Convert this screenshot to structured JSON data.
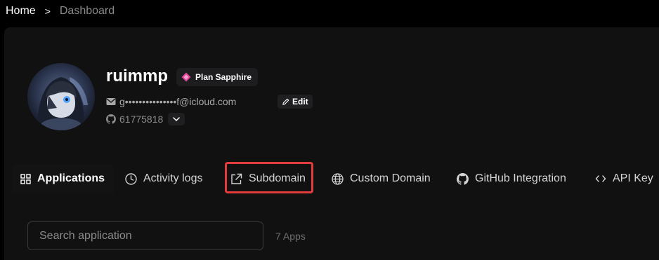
{
  "breadcrumb": {
    "home": "Home",
    "separator": ">",
    "current": "Dashboard"
  },
  "profile": {
    "username": "ruimmp",
    "plan_label": "Plan Sapphire",
    "email": "g•••••••••••••••f@icloud.com",
    "edit_label": "Edit",
    "github_id": "61775818",
    "plan_color": "#e0449c"
  },
  "tabs": [
    {
      "label": "Applications",
      "icon": "grid-icon",
      "active": true
    },
    {
      "label": "Activity logs",
      "icon": "clock-icon",
      "active": false
    },
    {
      "label": "Subdomain",
      "icon": "external-link-icon",
      "active": false
    },
    {
      "label": "Custom Domain",
      "icon": "globe-icon",
      "active": false
    },
    {
      "label": "GitHub Integration",
      "icon": "github-icon",
      "active": false
    },
    {
      "label": "API Key",
      "icon": "code-icon",
      "active": false
    }
  ],
  "search": {
    "placeholder": "Search application",
    "value": ""
  },
  "apps_count_label": "7 Apps",
  "highlight_color": "#e23c3c"
}
